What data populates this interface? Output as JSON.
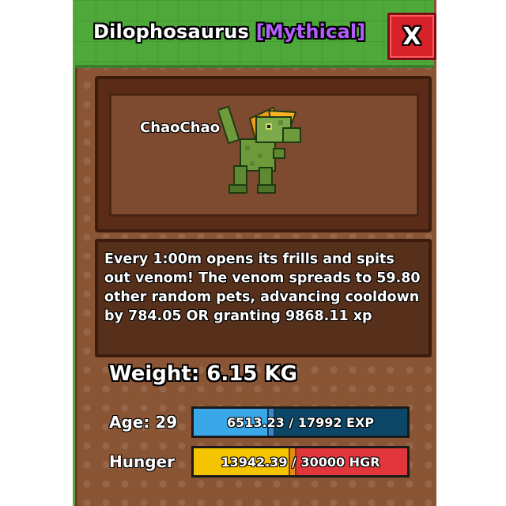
{
  "window": {
    "pet_species": "Dilophosaurus",
    "rarity": "[Mythical]",
    "close_label": "X"
  },
  "pet": {
    "name": "ChaoChao",
    "description": "Every 1:00m opens its frills and spits out venom! The venom spreads to 59.80 other random pets, advancing cooldown by 784.05 OR granting 9868.11 xp"
  },
  "stats": {
    "weight_text": "Weight: 6.15 KG",
    "age_text": "Age: 29",
    "hunger_label": "Hunger",
    "exp": {
      "current": 6513.23,
      "max": 17992,
      "text": "6513.23 / 17992 EXP"
    },
    "hunger": {
      "current": 13942.39,
      "max": 30000,
      "text": "13942.39 / 30000 HGR"
    }
  },
  "colors": {
    "header_green": "#4ea83a",
    "panel_brown": "#8a5535",
    "rarity_purple": "#b35dff",
    "close_red": "#d8222a",
    "exp_blue": "#3aa8e8",
    "hunger_yellow": "#f5c400",
    "hunger_empty_red": "#e0363c"
  }
}
